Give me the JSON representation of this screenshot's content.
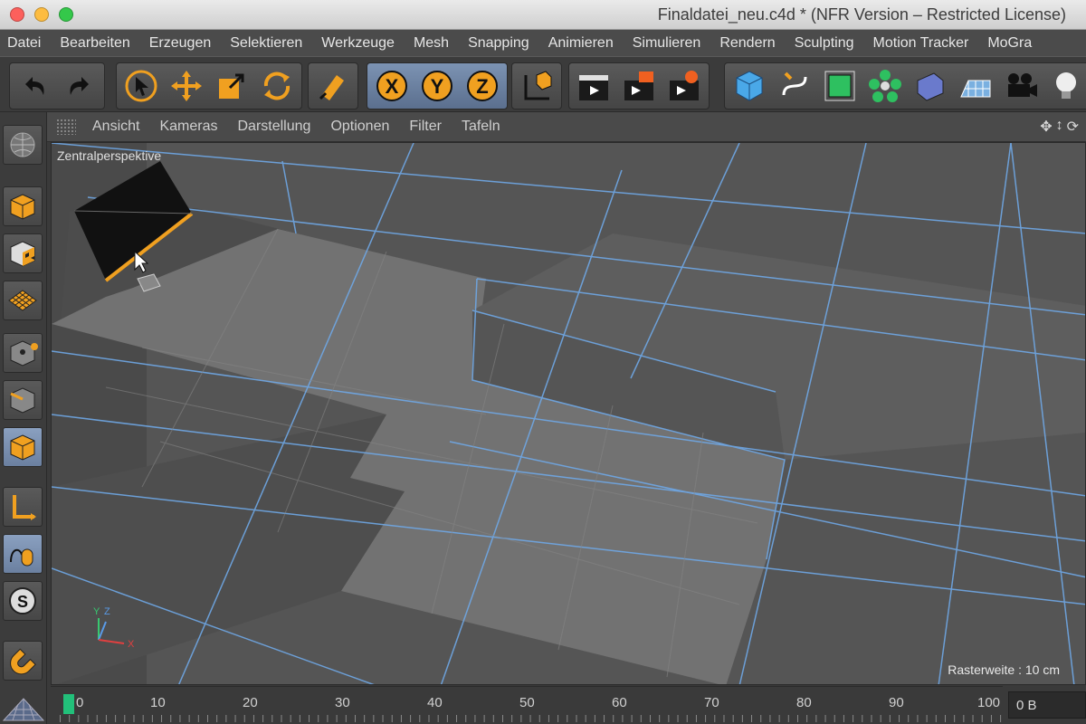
{
  "window": {
    "title": "Finaldatei_neu.c4d * (NFR Version – Restricted License)"
  },
  "menu": [
    "Datei",
    "Bearbeiten",
    "Erzeugen",
    "Selektieren",
    "Werkzeuge",
    "Mesh",
    "Snapping",
    "Animieren",
    "Simulieren",
    "Rendern",
    "Sculpting",
    "Motion Tracker",
    "MoGra"
  ],
  "viewport_menu": [
    "Ansicht",
    "Kameras",
    "Darstellung",
    "Optionen",
    "Filter",
    "Tafeln"
  ],
  "viewport": {
    "camera_label": "Zentralperspektive",
    "grid_info": "Rasterweite : 10 cm",
    "axis": {
      "y": "Y",
      "z": "Z",
      "x": "X"
    }
  },
  "timeline": {
    "ticks": [
      "0",
      "10",
      "20",
      "30",
      "40",
      "50",
      "60",
      "70",
      "80",
      "90",
      "100"
    ],
    "current_frame_box": "0 B"
  },
  "icons": {
    "toolbar": [
      "undo-icon",
      "redo-icon",
      "select-icon",
      "move-icon",
      "scale-icon",
      "rotate-icon",
      "tool-icon",
      "x-axis-icon",
      "y-axis-icon",
      "z-axis-icon",
      "coordinate-system-icon",
      "render-view-icon",
      "render-picture-viewer-icon",
      "render-settings-icon",
      "cube-icon",
      "spline-pen-icon",
      "subdivision-icon",
      "mograph-cloner-icon",
      "deformer-icon",
      "floor-icon",
      "camera-icon",
      "light-icon"
    ],
    "left": [
      "make-editable-icon",
      "model-mode-icon",
      "texture-mode-icon",
      "workplane-icon",
      "points-mode-icon",
      "edges-mode-icon",
      "polygons-mode-icon",
      "axis-mode-icon",
      "tweak-mode-icon",
      "snap-icon",
      "magnet-icon"
    ]
  },
  "colors": {
    "accent_blue": "#6fa8e6",
    "selection_orange": "#f0a020",
    "viewport_bg": "#5a5a5a"
  }
}
